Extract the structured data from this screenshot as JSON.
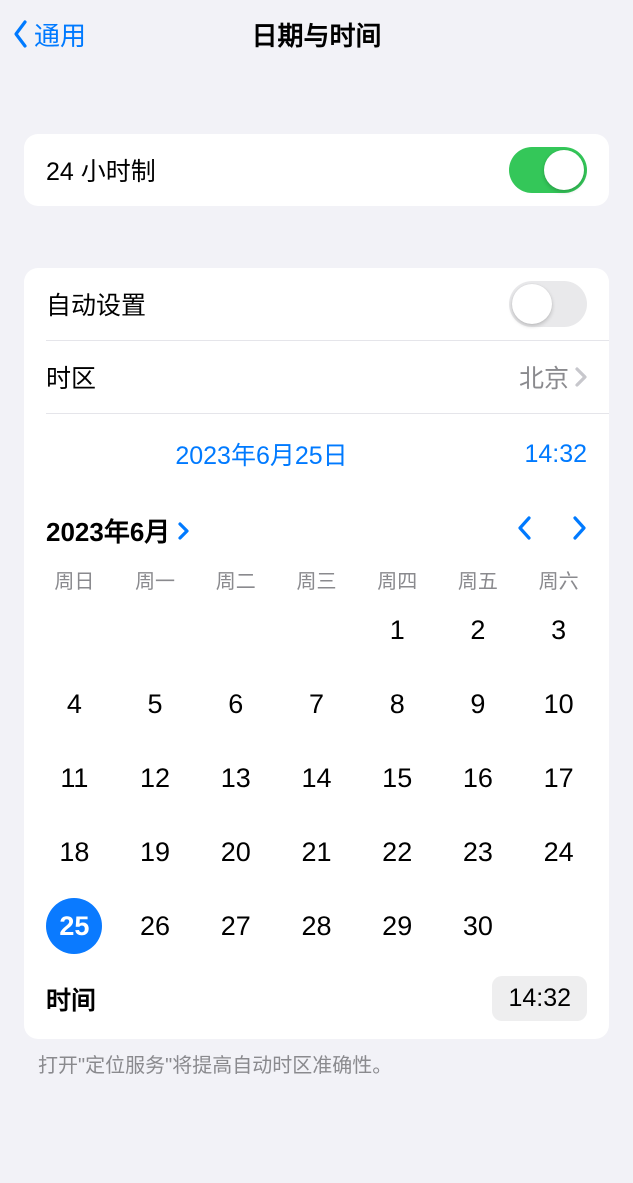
{
  "header": {
    "back": "通用",
    "title": "日期与时间"
  },
  "rows": {
    "hour24": {
      "label": "24 小时制",
      "on": true
    },
    "auto": {
      "label": "自动设置",
      "on": false
    },
    "tz": {
      "label": "时区",
      "value": "北京"
    }
  },
  "summary": {
    "date": "2023年6月25日",
    "time": "14:32"
  },
  "calendar": {
    "month_label": "2023年6月",
    "weekdays": [
      "周日",
      "周一",
      "周二",
      "周三",
      "周四",
      "周五",
      "周六"
    ],
    "first_weekday_index": 4,
    "days_in_month": 30,
    "selected_day": 25
  },
  "time_row": {
    "label": "时间",
    "value": "14:32"
  },
  "footer": "打开\"定位服务\"将提高自动时区准确性。"
}
